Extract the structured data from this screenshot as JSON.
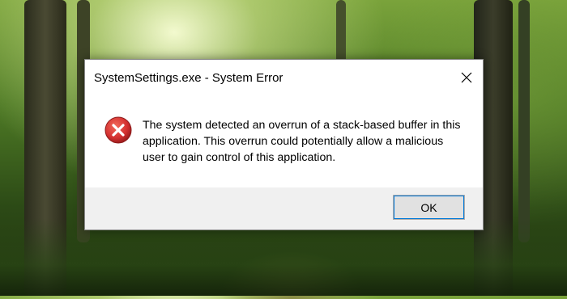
{
  "dialog": {
    "title": "SystemSettings.exe - System Error",
    "message": "The system detected an overrun of a stack-based buffer in this application. This overrun could potentially allow a malicious user to gain control of this application.",
    "ok_label": "OK",
    "icons": {
      "close": "close-icon",
      "error": "error-icon"
    }
  },
  "colors": {
    "error_red": "#d32f2f",
    "dialog_bg": "#ffffff",
    "footer_bg": "#f0f0f0",
    "button_bg": "#e1e1e1",
    "focus_border": "#0078d7"
  }
}
